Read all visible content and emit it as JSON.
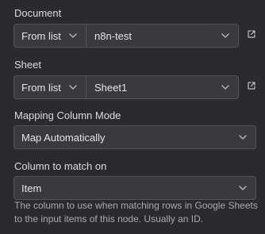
{
  "document": {
    "label": "Document",
    "mode": "From list",
    "value": "n8n-test",
    "open_icon": "external-link-icon"
  },
  "sheet": {
    "label": "Sheet",
    "mode": "From list",
    "value": "Sheet1",
    "open_icon": "external-link-icon"
  },
  "mapping": {
    "label": "Mapping Column Mode",
    "value": "Map Automatically"
  },
  "column_to_match": {
    "label": "Column to match on",
    "value": "Item",
    "hint": "The column to use when matching rows in Google Sheets to the input items of this node. Usually an ID."
  },
  "colors": {
    "background": "#2b2b2d",
    "input_background": "#3a3a3d",
    "border": "#545457"
  }
}
